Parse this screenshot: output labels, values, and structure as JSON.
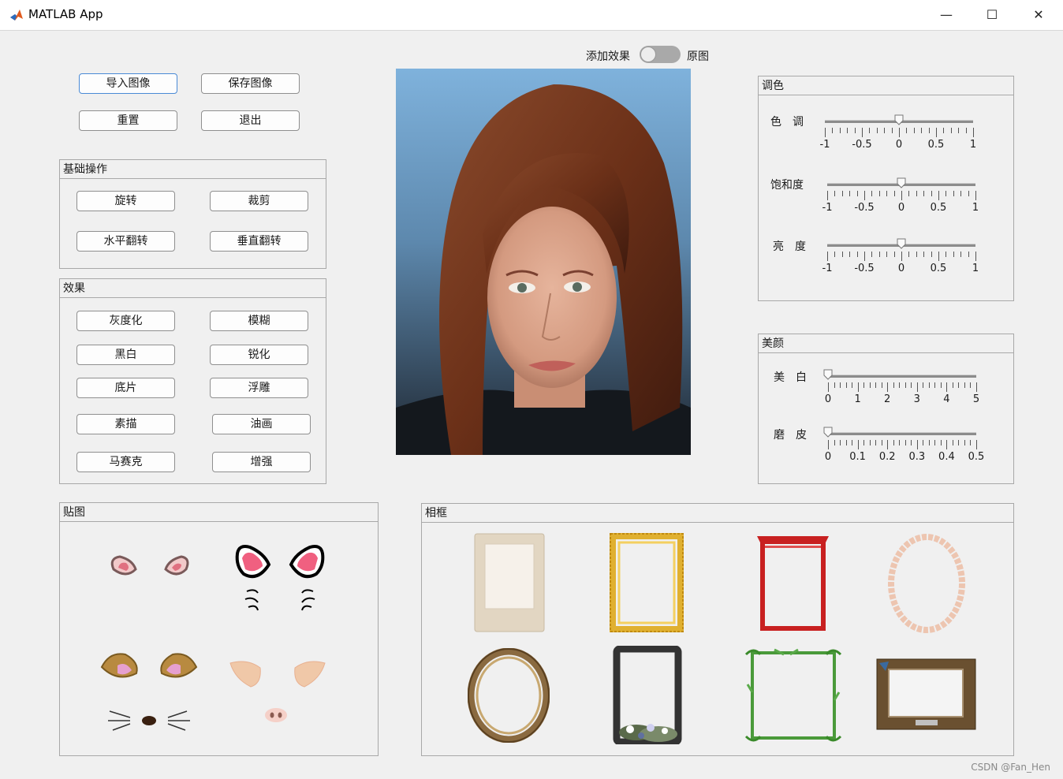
{
  "window": {
    "title": "MATLAB App",
    "minimize": "—",
    "maximize": "☐",
    "close": "✕"
  },
  "toolbar": {
    "import": "导入图像",
    "save": "保存图像",
    "reset": "重置",
    "exit": "退出"
  },
  "basic": {
    "title": "基础操作",
    "rotate": "旋转",
    "crop": "裁剪",
    "flip_h": "水平翻转",
    "flip_v": "垂直翻转"
  },
  "effects": {
    "title": "效果",
    "gray": "灰度化",
    "blur": "模糊",
    "bw": "黑白",
    "sharpen": "锐化",
    "negative": "底片",
    "emboss": "浮雕",
    "sketch": "素描",
    "oil": "油画",
    "mosaic": "马赛克",
    "enhance": "增强"
  },
  "toggle": {
    "left_label": "添加效果",
    "right_label": "原图",
    "state": "off"
  },
  "color": {
    "title": "调色",
    "hue": {
      "label": "色　调",
      "value": 0,
      "ticks": [
        "-1",
        "-0.5",
        "0",
        "0.5",
        "1"
      ]
    },
    "saturation": {
      "label": "饱和度",
      "value": 0,
      "ticks": [
        "-1",
        "-0.5",
        "0",
        "0.5",
        "1"
      ]
    },
    "brightness": {
      "label": "亮　度",
      "value": 0,
      "ticks": [
        "-1",
        "-0.5",
        "0",
        "0.5",
        "1"
      ]
    }
  },
  "beauty": {
    "title": "美颜",
    "whiten": {
      "label": "美　白",
      "value": 0,
      "ticks": [
        "0",
        "1",
        "2",
        "3",
        "4",
        "5"
      ]
    },
    "smooth": {
      "label": "磨　皮",
      "value": 0,
      "ticks": [
        "0",
        "0.1",
        "0.2",
        "0.3",
        "0.4",
        "0.5"
      ]
    }
  },
  "stickers": {
    "title": "贴图",
    "items": [
      "bunny-ears-icon",
      "cat-ears-whiskers-icon",
      "dog-ears-nose-icon",
      "pig-ears-nose-icon"
    ]
  },
  "frames": {
    "title": "相框",
    "items": [
      "vintage-paper-frame-icon",
      "gold-ornate-frame-icon",
      "red-gate-frame-icon",
      "pink-oval-frame-icon",
      "antique-oval-frame-icon",
      "black-floral-frame-icon",
      "bamboo-frame-icon",
      "wooden-frame-icon"
    ]
  },
  "watermark": "CSDN @Fan_Hen",
  "colors": {
    "accent": "#4a8ad6",
    "window_bg": "#f0f0f0"
  }
}
